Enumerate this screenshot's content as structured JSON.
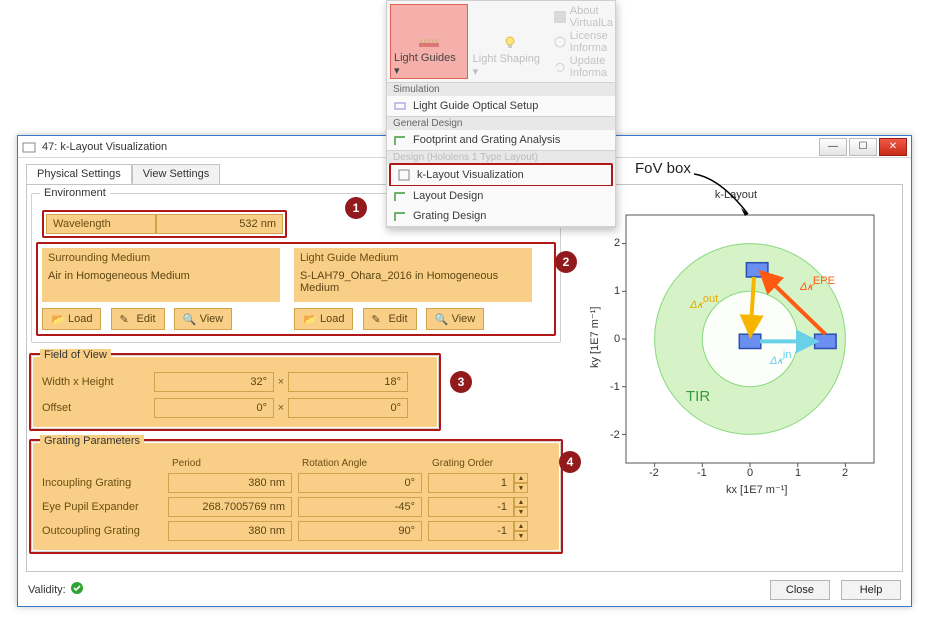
{
  "ribbon": {
    "light_guides": "Light Guides ▾",
    "light_shaping": "Light Shaping ▾",
    "about": "About VirtualLa",
    "license": "License Informa",
    "update": "Update Informa",
    "sect_sim": "Simulation",
    "item_setup": "Light Guide Optical Setup",
    "sect_general": "General Design",
    "item_footprint": "Footprint and Grating Analysis",
    "sect_hololens": "Design (Hololens 1 Type Layout)",
    "item_klayout": "k-Layout Visualization",
    "item_layout": "Layout Design",
    "item_grating": "Grating Design"
  },
  "window": {
    "title": "47: k-Layout Visualization"
  },
  "tabs": {
    "physical": "Physical Settings",
    "view": "View Settings"
  },
  "env": {
    "title": "Environment",
    "wavelength_label": "Wavelength",
    "wavelength_value": "532 nm",
    "surr_title": "Surrounding Medium",
    "surr_text": "Air in Homogeneous Medium",
    "lg_title": "Light Guide Medium",
    "lg_text": "S-LAH79_Ohara_2016 in Homogeneous Medium",
    "load": "Load",
    "edit": "Edit",
    "view": "View"
  },
  "fov": {
    "title": "Field of View",
    "wh_label": "Width x Height",
    "width": "32°",
    "height": "18°",
    "offset_label": "Offset",
    "ox": "0°",
    "oy": "0°"
  },
  "grating": {
    "title": "Grating Parameters",
    "col_period": "Period",
    "col_rot": "Rotation Angle",
    "col_order": "Grating Order",
    "rows": [
      {
        "name": "Incoupling Grating",
        "period": "380 nm",
        "rot": "0°",
        "order": "1"
      },
      {
        "name": "Eye Pupil Expander",
        "period": "268.7005769 nm",
        "rot": "-45°",
        "order": "-1"
      },
      {
        "name": "Outcoupling Grating",
        "period": "380 nm",
        "rot": "90°",
        "order": "-1"
      }
    ]
  },
  "annotations": {
    "b1": "1",
    "b2": "2",
    "b3": "3",
    "b4": "4",
    "fov": "FoV box",
    "tir": "TIR",
    "dk_in": "Δ𝜅",
    "dk_in_sup": "in",
    "dk_out": "Δ𝜅",
    "dk_out_sup": "out",
    "dk_epe": "Δ𝜅",
    "dk_epe_sup": "EPE"
  },
  "chart": {
    "title": "k-Layout",
    "xlabel": "kx [1E7 m⁻¹]",
    "ylabel": "ky [1E7 m⁻¹]",
    "xticks": [
      "-2",
      "-1",
      "0",
      "1",
      "2"
    ],
    "yticks": [
      "-2",
      "-1",
      "0",
      "1",
      "2"
    ]
  },
  "footer": {
    "validity": "Validity:",
    "close": "Close",
    "help": "Help"
  },
  "chart_data": {
    "type": "scatter",
    "title": "k-Layout",
    "xlabel": "kx [1E7 m⁻¹]",
    "ylabel": "ky [1E7 m⁻¹]",
    "xlim": [
      -2.6,
      2.6
    ],
    "ylim": [
      -2.6,
      2.6
    ],
    "circles": [
      {
        "name": "outer",
        "cx": 0,
        "cy": 0,
        "r": 2.0
      },
      {
        "name": "inner",
        "cx": 0,
        "cy": 0,
        "r": 1.0
      }
    ],
    "boxes": [
      {
        "name": "epe",
        "cx": 0.15,
        "cy": 1.45,
        "w": 0.45,
        "h": 0.3
      },
      {
        "name": "center",
        "cx": 0.0,
        "cy": -0.05,
        "w": 0.45,
        "h": 0.3
      },
      {
        "name": "in",
        "cx": 1.58,
        "cy": -0.05,
        "w": 0.45,
        "h": 0.3
      }
    ],
    "arrows": [
      {
        "name": "dk_in",
        "from_box": "center",
        "to_box": "in",
        "color": "#6ad0e8"
      },
      {
        "name": "dk_epe",
        "from_box": "in",
        "to_box": "epe",
        "color": "#ff5a12"
      },
      {
        "name": "dk_out",
        "from_box": "epe",
        "to_box": "center",
        "color": "#f7b500"
      }
    ]
  }
}
